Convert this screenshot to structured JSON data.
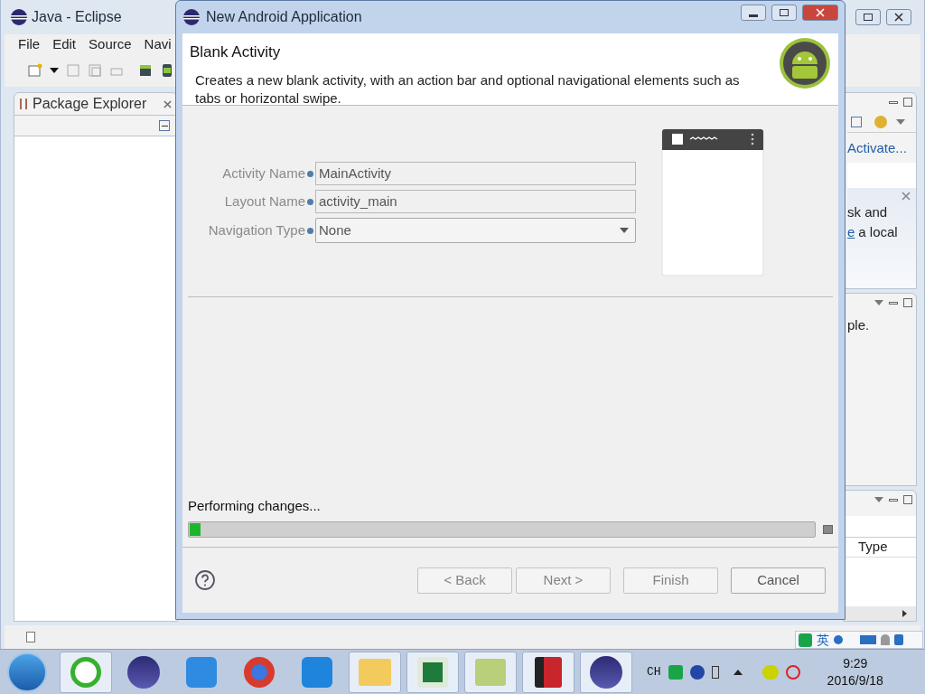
{
  "eclipse": {
    "title": "Java - Eclipse",
    "menu": [
      "File",
      "Edit",
      "Source",
      "Navi"
    ],
    "package_explorer": {
      "title": "Package Explorer"
    },
    "task_panel": {
      "link": "Activate...",
      "welcome_line_1": "sk and",
      "welcome_link": "e",
      "welcome_line_2": "a local"
    },
    "console_panel": {
      "text": "ple."
    },
    "problems_panel": {
      "column": "Type"
    }
  },
  "dialog": {
    "title": "New Android Application",
    "heading": "Blank Activity",
    "description": "Creates a new blank activity, with an action bar and optional navigational elements such as tabs or horizontal swipe.",
    "fields": [
      {
        "kind": "text",
        "label": "Activity Name",
        "value": "MainActivity",
        "disabled": true
      },
      {
        "kind": "text",
        "label": "Layout Name",
        "value": "activity_main",
        "disabled": true
      },
      {
        "kind": "select",
        "label": "Navigation Type",
        "value": "None",
        "disabled": true
      }
    ],
    "progress": {
      "label": "Performing changes...",
      "level": 0.01
    },
    "buttons": [
      {
        "label": "< Back",
        "disabled": true
      },
      {
        "label": "Next >",
        "disabled": true
      },
      {
        "label": "Finish",
        "disabled": true
      },
      {
        "label": "Cancel",
        "disabled": false
      }
    ]
  },
  "ime": {
    "label": "英"
  },
  "taskbar": {
    "language": "CH",
    "time": "9:29",
    "date": "2016/9/18"
  }
}
